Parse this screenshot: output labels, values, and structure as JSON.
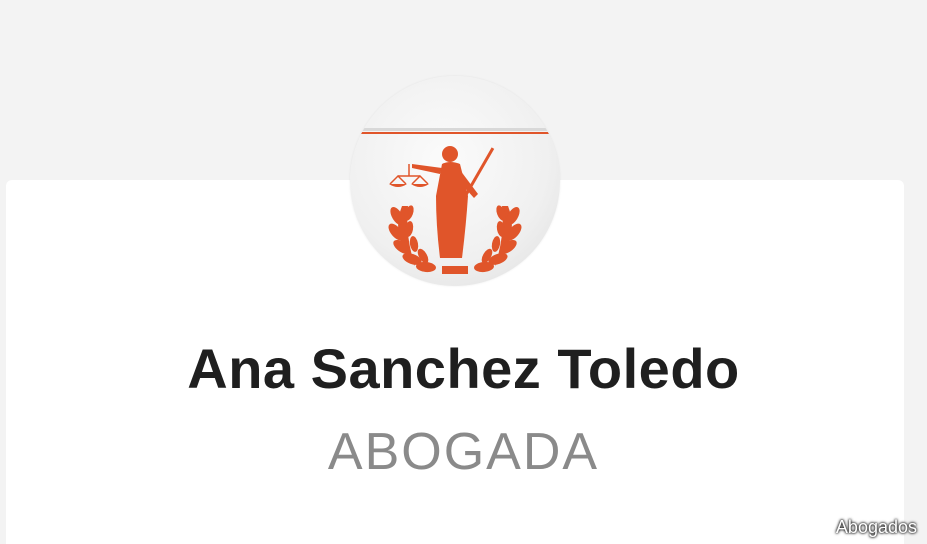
{
  "profile": {
    "name": "Ana Sanchez Toledo",
    "role": "ABOGADA",
    "avatar_icon": "lady-justice-logo-icon"
  },
  "watermark": "Abogados",
  "colors": {
    "accent": "#e0552a",
    "name_text": "#1f1f1f",
    "role_text": "#8a8a8a",
    "background": "#f3f3f3",
    "card": "#ffffff"
  }
}
